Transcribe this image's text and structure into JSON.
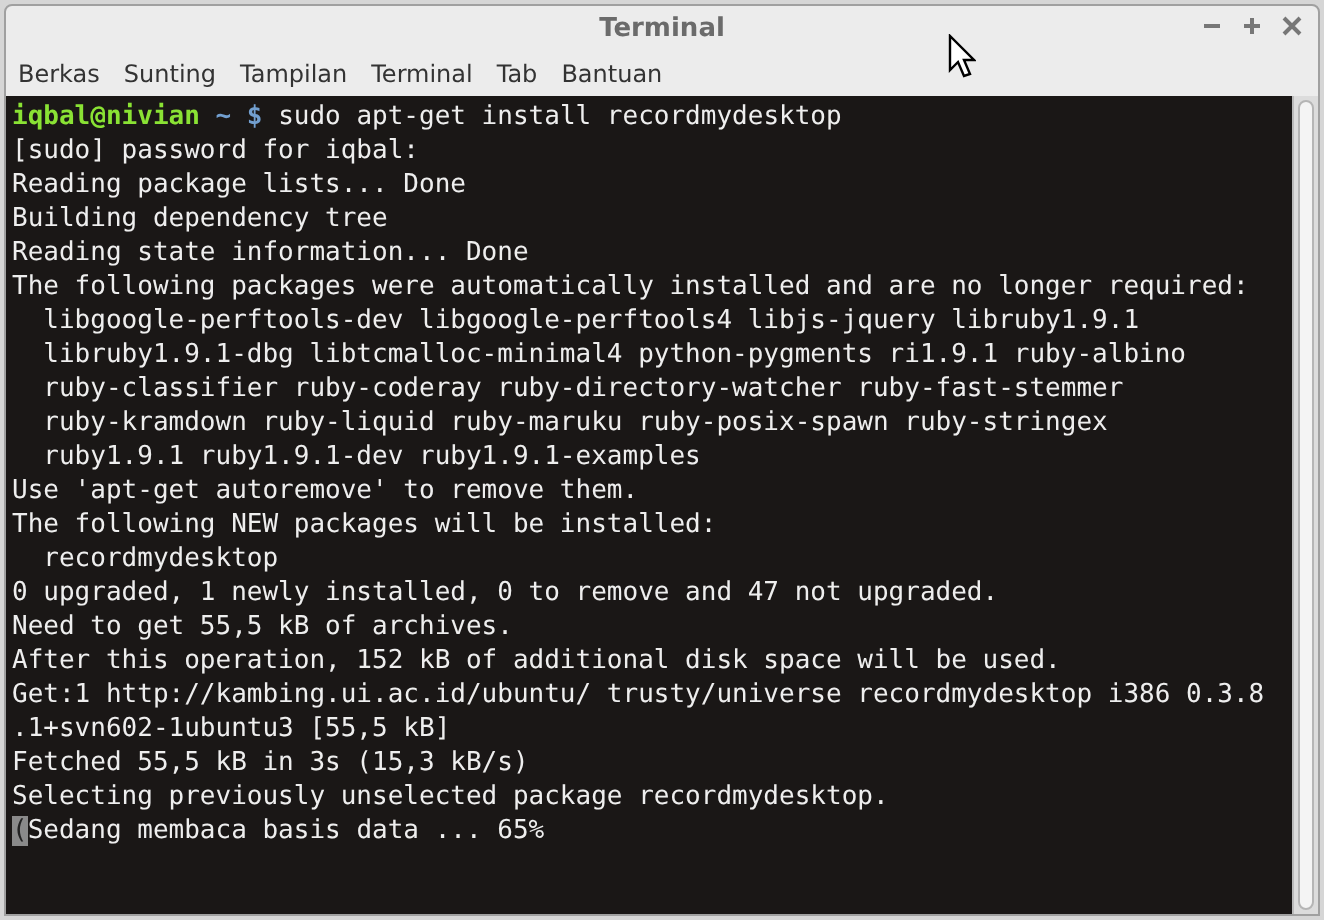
{
  "window": {
    "title": "Terminal"
  },
  "menu": [
    "Berkas",
    "Sunting",
    "Tampilan",
    "Terminal",
    "Tab",
    "Bantuan"
  ],
  "terminal": {
    "prompt": {
      "user_host": "iqbal@nivian",
      "path": "~",
      "symbol": "$",
      "command": "sudo apt-get install recordmydesktop"
    },
    "lines": [
      "[sudo] password for iqbal:",
      "Reading package lists... Done",
      "Building dependency tree",
      "Reading state information... Done",
      "The following packages were automatically installed and are no longer required:",
      "  libgoogle-perftools-dev libgoogle-perftools4 libjs-jquery libruby1.9.1",
      "  libruby1.9.1-dbg libtcmalloc-minimal4 python-pygments ri1.9.1 ruby-albino",
      "  ruby-classifier ruby-coderay ruby-directory-watcher ruby-fast-stemmer",
      "  ruby-kramdown ruby-liquid ruby-maruku ruby-posix-spawn ruby-stringex",
      "  ruby1.9.1 ruby1.9.1-dev ruby1.9.1-examples",
      "Use 'apt-get autoremove' to remove them.",
      "The following NEW packages will be installed:",
      "  recordmydesktop",
      "0 upgraded, 1 newly installed, 0 to remove and 47 not upgraded.",
      "Need to get 55,5 kB of archives.",
      "After this operation, 152 kB of additional disk space will be used.",
      "Get:1 http://kambing.ui.ac.id/ubuntu/ trusty/universe recordmydesktop i386 0.3.8",
      ".1+svn602-1ubuntu3 [55,5 kB]",
      "Fetched 55,5 kB in 3s (15,3 kB/s)",
      "Selecting previously unselected package recordmydesktop."
    ],
    "cursor_line": {
      "cursor_char": "(",
      "text": "Sedang membaca basis data ... 65%"
    }
  }
}
